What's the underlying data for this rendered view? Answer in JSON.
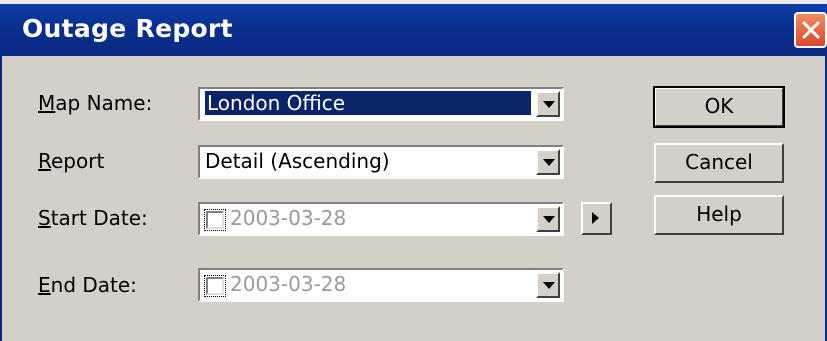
{
  "window": {
    "title": "Outage Report"
  },
  "form": {
    "map_name": {
      "label_accel": "M",
      "label_rest": "ap Name:",
      "value": "London Office"
    },
    "report": {
      "label_accel": "R",
      "label_rest": "eport",
      "value": "Detail (Ascending)"
    },
    "start_date": {
      "label_accel": "S",
      "label_rest": "tart Date:",
      "value": "2003-03-28",
      "checked": false
    },
    "end_date": {
      "label_accel": "E",
      "label_rest": "nd Date:",
      "value": "2003-03-28",
      "checked": false
    }
  },
  "buttons": {
    "ok": "OK",
    "cancel": "Cancel",
    "help": "Help"
  },
  "icons": [
    "close-icon",
    "dropdown-arrow-icon",
    "right-arrow-icon"
  ],
  "colors": {
    "titlebar": "#0a2a83",
    "selection": "#0a246a",
    "face": "#d4d0c8",
    "close": "#d8492a"
  }
}
